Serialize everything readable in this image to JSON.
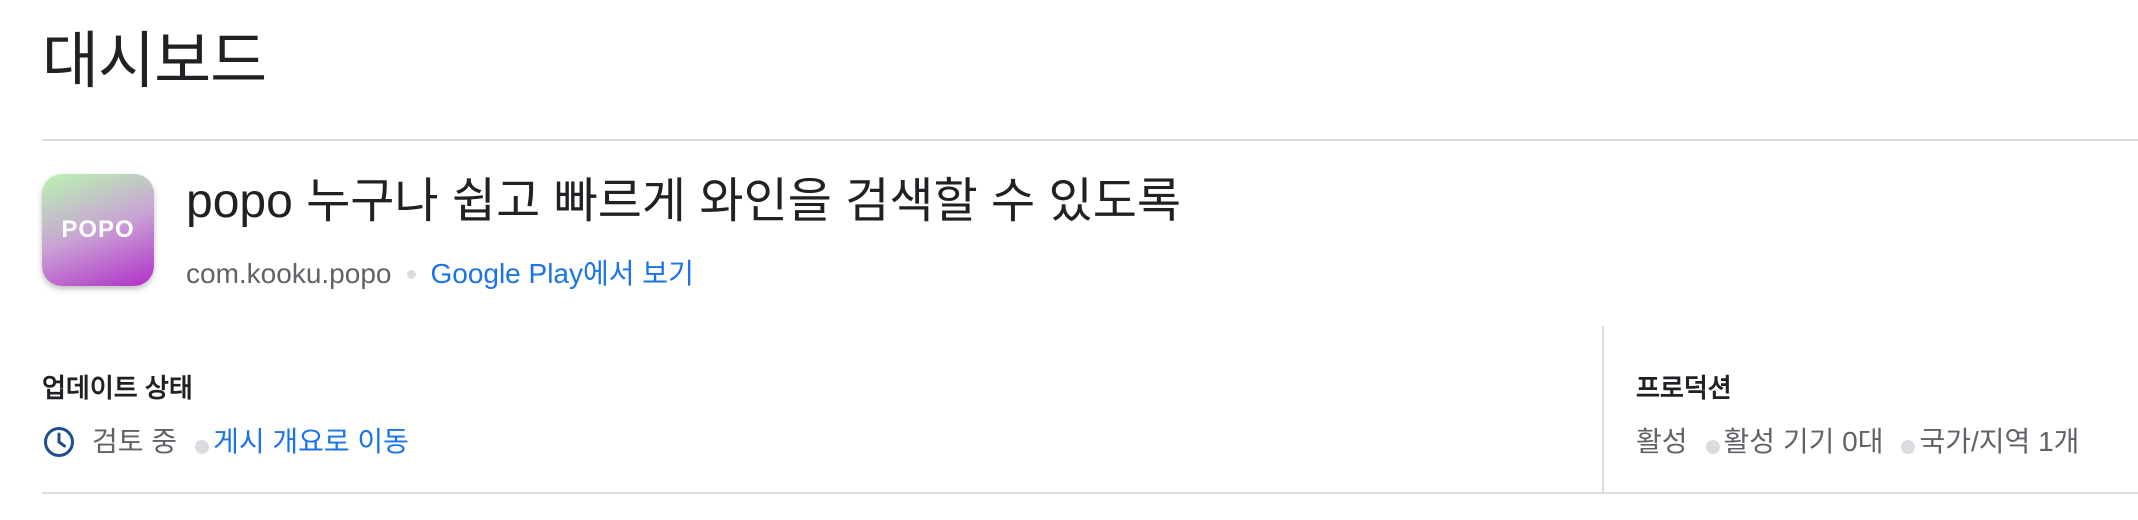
{
  "page": {
    "title": "대시보드"
  },
  "app": {
    "icon_text": "POPO",
    "name": "popo 누구나 쉽고 빠르게 와인을 검색할 수 있도록",
    "package": "com.kooku.popo",
    "play_link": "Google Play에서 보기"
  },
  "update_status": {
    "label": "업데이트 상태",
    "icon": "clock-icon",
    "status": "검토 중",
    "link": "게시 개요로 이동"
  },
  "production": {
    "label": "프로덕션",
    "state": "활성",
    "active_devices": "활성 기기 0대",
    "countries": "국가/지역 1개"
  },
  "colors": {
    "link": "#1a73e8",
    "text": "#202124",
    "muted": "#5f6368",
    "divider": "#dadce0",
    "icon_gradient_start": "#b8f5b0",
    "icon_gradient_end": "#b12fc9"
  }
}
